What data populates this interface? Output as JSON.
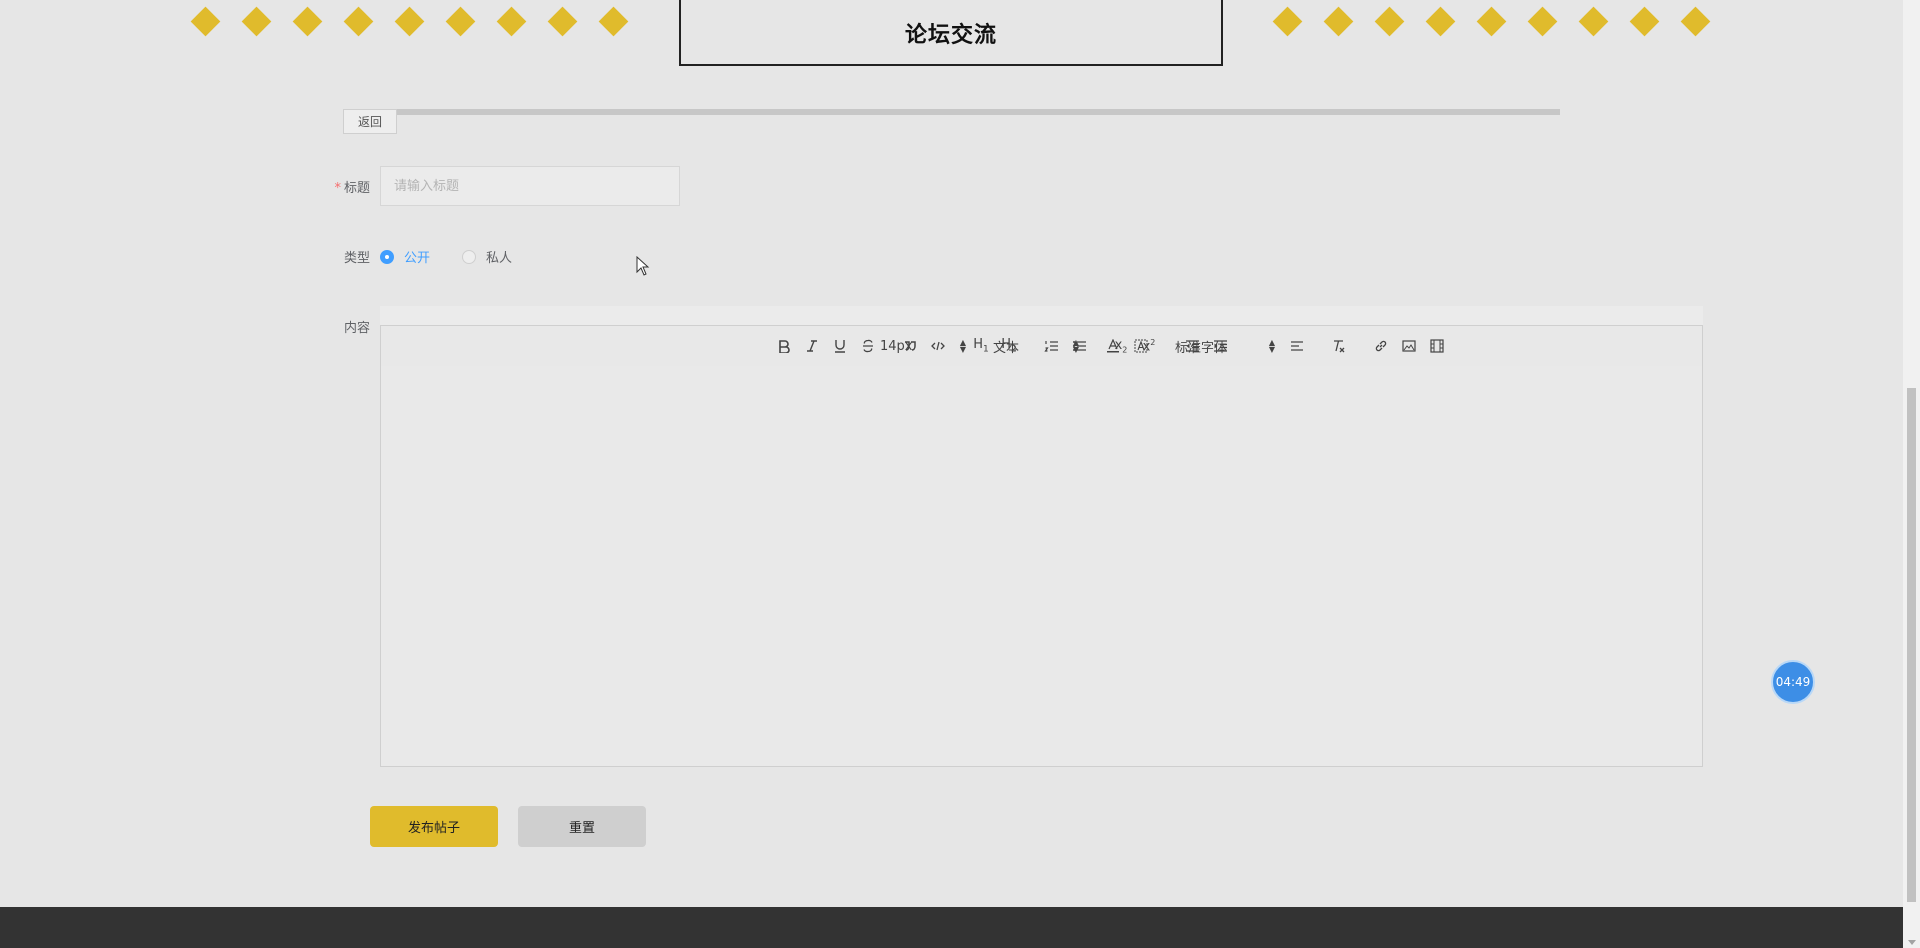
{
  "header": {
    "title": "论坛交流"
  },
  "nav": {
    "back_label": "返回"
  },
  "form": {
    "title_label": "标题",
    "required_mark": "*",
    "title_placeholder": "请输入标题",
    "title_value": "",
    "type_label": "类型",
    "type_options": [
      {
        "label": "公开",
        "checked": true
      },
      {
        "label": "私人",
        "checked": false
      }
    ],
    "content_label": "内容"
  },
  "editor": {
    "toolbar": {
      "bold": "bold-icon",
      "italic": "italic-icon",
      "underline": "underline-icon",
      "strike": "strike-icon",
      "blockquote": "blockquote-icon",
      "code_block": "code-block-icon",
      "h1": "H1",
      "h2": "H2",
      "ordered_list": "ordered-list-icon",
      "bullet_list": "bullet-list-icon",
      "subscript": "subscript-icon",
      "superscript": "superscript-icon",
      "outdent": "outdent-icon",
      "indent": "indent-icon",
      "size_value": "14px",
      "header_value": "文本",
      "color": "font-color-icon",
      "background": "background-color-icon",
      "font_value": "标准字体",
      "align": "align-icon",
      "clean": "clear-format-icon",
      "link": "link-icon",
      "image": "image-icon",
      "video": "video-icon"
    },
    "content": ""
  },
  "actions": {
    "submit_label": "发布帖子",
    "reset_label": "重置"
  },
  "timer": {
    "value": "04:49"
  },
  "colors": {
    "accent": "#e0bb2c",
    "primary_blue": "#409eff",
    "background": "#e6e6e6",
    "footer": "#333333"
  }
}
